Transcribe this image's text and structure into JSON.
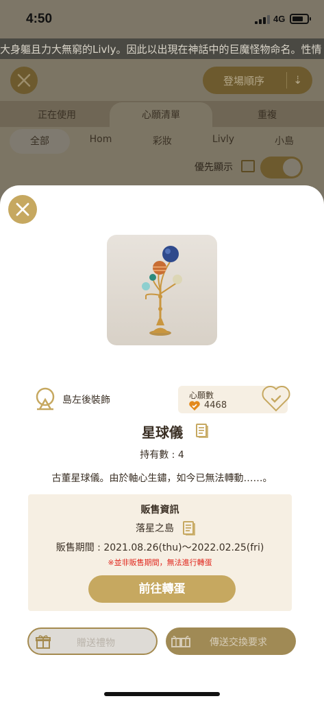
{
  "status_bar": {
    "time": "4:50",
    "network": "4G"
  },
  "marquee": {
    "text": "大身軀且力大無窮的Livly。因此以出現在神話中的巨魔怪物命名。性情"
  },
  "background": {
    "sort_label": "登場順序",
    "tabs": [
      {
        "label": "正在使用"
      },
      {
        "label": "心願清單"
      },
      {
        "label": "重複"
      }
    ],
    "categories": [
      {
        "label": "全部"
      },
      {
        "label": "Hom"
      },
      {
        "label": "彩妝"
      },
      {
        "label": "Livly"
      },
      {
        "label": "小島"
      }
    ],
    "priority_label": "優先顯示"
  },
  "item": {
    "slot": "島左後裝飾",
    "wish_title": "心願數",
    "wish_count": "4468",
    "name": "星球儀",
    "owned": "持有數 : 4",
    "description": "古董星球儀。由於軸心生鏽，如今已無法轉動……。"
  },
  "sale_info": {
    "title": "販售資訊",
    "source": "落星之島",
    "period": "販售期間 : 2021.08.26(thu)～2022.02.25(fri)",
    "note": "※並非販售期間，無法進行轉蛋",
    "go_button": "前往轉蛋"
  },
  "actions": {
    "gift_button": "贈送禮物",
    "trade_button": "傳送交換要求"
  },
  "colors": {
    "accent": "#c6a860",
    "panel": "#f6efe3",
    "note": "#e0261c"
  }
}
